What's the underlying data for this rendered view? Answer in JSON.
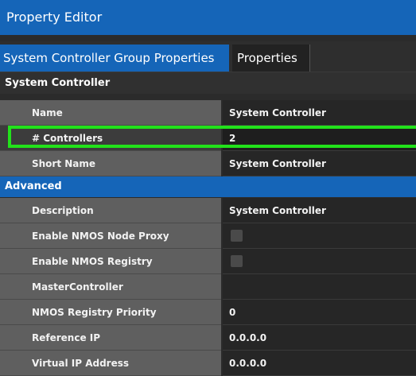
{
  "window": {
    "title": "Property Editor"
  },
  "tabs": [
    {
      "label": "System Controller Group Properties",
      "active": true
    },
    {
      "label": "Properties",
      "active": false
    }
  ],
  "sections": {
    "system_controller": "System Controller",
    "advanced": "Advanced"
  },
  "system_rows": [
    {
      "label": "Name",
      "value": "System Controller"
    },
    {
      "label": "# Controllers",
      "value": "2"
    },
    {
      "label": "Short Name",
      "value": "System Controller"
    }
  ],
  "advanced_rows": [
    {
      "label": "Description",
      "value": "System Controller"
    },
    {
      "label": "Enable NMOS Node Proxy",
      "value": "",
      "checkbox": true,
      "checked": false
    },
    {
      "label": "Enable NMOS Registry",
      "value": "",
      "checkbox": true,
      "checked": false
    },
    {
      "label": "MasterController",
      "value": ""
    },
    {
      "label": "NMOS Registry Priority",
      "value": "0"
    },
    {
      "label": "Reference IP",
      "value": "0.0.0.0"
    },
    {
      "label": "Virtual IP Address",
      "value": "0.0.0.0"
    }
  ],
  "colors": {
    "accent": "#1565b8",
    "highlight": "#22e21b"
  }
}
